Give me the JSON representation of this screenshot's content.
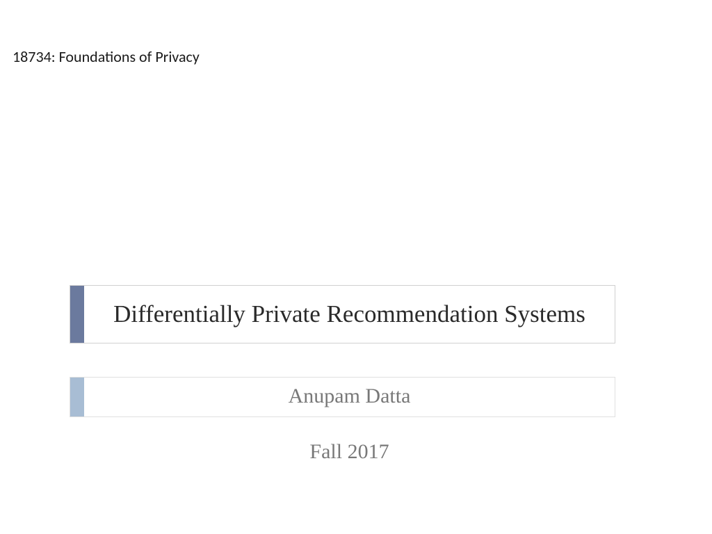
{
  "course": "18734: Foundations of Privacy",
  "title": "Differentially Private Recommendation Systems",
  "author": "Anupam Datta",
  "term": "Fall 2017"
}
